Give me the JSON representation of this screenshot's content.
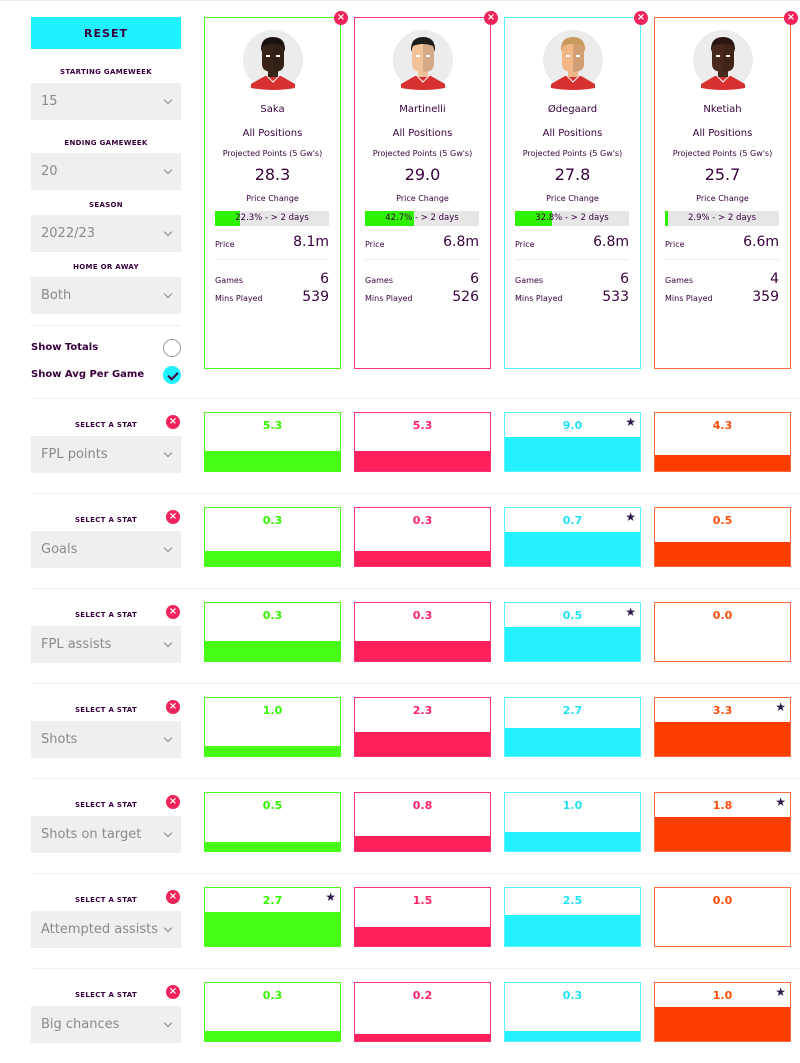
{
  "controls": {
    "reset_label": "RESET",
    "starting_gameweek": {
      "label": "STARTING GAMEWEEK",
      "value": "15"
    },
    "ending_gameweek": {
      "label": "ENDING GAMEWEEK",
      "value": "20"
    },
    "season": {
      "label": "SEASON",
      "value": "2022/23"
    },
    "home_or_away": {
      "label": "HOME OR AWAY",
      "value": "Both"
    },
    "show_totals": {
      "label": "Show Totals",
      "checked": false
    },
    "show_avg": {
      "label": "Show Avg Per Game",
      "checked": true
    }
  },
  "players": [
    {
      "name": "Saka",
      "position": "All Positions",
      "projected_label": "Projected Points (5 Gw's)",
      "projected": "28.3",
      "price_change_label": "Price Change",
      "price_change_pct": 22.3,
      "price_change_text": "22.3% - > 2 days",
      "price_label": "Price",
      "price": "8.1m",
      "games_label": "Games",
      "games": "6",
      "mins_label": "Mins Played",
      "mins": "539",
      "color": "#4cff1a",
      "fill": "#47ff14",
      "text_color": "#36f500",
      "skin": "#3a2418",
      "hair": "#1a1210"
    },
    {
      "name": "Martinelli",
      "position": "All Positions",
      "projected_label": "Projected Points (5 Gw's)",
      "projected": "29.0",
      "price_change_label": "Price Change",
      "price_change_pct": 42.7,
      "price_change_text": "42.7% - > 2 days",
      "price_label": "Price",
      "price": "6.8m",
      "games_label": "Games",
      "games": "6",
      "mins_label": "Mins Played",
      "mins": "526",
      "color": "#ff2f73",
      "fill": "#ff1f5a",
      "text_color": "#ff2466",
      "skin": "#f2c29a",
      "hair": "#1d1d1d"
    },
    {
      "name": "Ødegaard",
      "position": "All Positions",
      "projected_label": "Projected Points (5 Gw's)",
      "projected": "27.8",
      "price_change_label": "Price Change",
      "price_change_pct": 32.8,
      "price_change_text": "32.8% - > 2 days",
      "price_label": "Price",
      "price": "6.8m",
      "games_label": "Games",
      "games": "6",
      "mins_label": "Mins Played",
      "mins": "533",
      "color": "#55f3ff",
      "fill": "#26f2ff",
      "text_color": "#1fe3f5",
      "skin": "#f0b686",
      "hair": "#c99a5d"
    },
    {
      "name": "Nketiah",
      "position": "All Positions",
      "projected_label": "Projected Points (5 Gw's)",
      "projected": "25.7",
      "price_change_label": "Price Change",
      "price_change_pct": 2.9,
      "price_change_text": "2.9% - > 2 days",
      "price_label": "Price",
      "price": "6.6m",
      "games_label": "Games",
      "games": "4",
      "mins_label": "Mins Played",
      "mins": "359",
      "color": "#ff6a3d",
      "fill": "#ff3d00",
      "text_color": "#ff4d0a",
      "skin": "#4a2a1c",
      "hair": "#2a1712"
    }
  ],
  "stat_label": "SELECT A STAT",
  "stats": [
    {
      "name": "FPL points",
      "values": [
        "5.3",
        "5.3",
        "9.0",
        "4.3"
      ],
      "best": 2
    },
    {
      "name": "Goals",
      "values": [
        "0.3",
        "0.3",
        "0.7",
        "0.5"
      ],
      "best": 2
    },
    {
      "name": "FPL assists",
      "values": [
        "0.3",
        "0.3",
        "0.5",
        "0.0"
      ],
      "best": 2
    },
    {
      "name": "Shots",
      "values": [
        "1.0",
        "2.3",
        "2.7",
        "3.3"
      ],
      "best": 3
    },
    {
      "name": "Shots on target",
      "values": [
        "0.5",
        "0.8",
        "1.0",
        "1.8"
      ],
      "best": 3
    },
    {
      "name": "Attempted assists",
      "values": [
        "2.7",
        "1.5",
        "2.5",
        "0.0"
      ],
      "best": 0
    },
    {
      "name": "Big chances",
      "values": [
        "0.3",
        "0.2",
        "0.3",
        "1.0"
      ],
      "best": 3
    }
  ],
  "icons": {
    "close": "×",
    "star": "★",
    "chevron": "chevron-down"
  }
}
